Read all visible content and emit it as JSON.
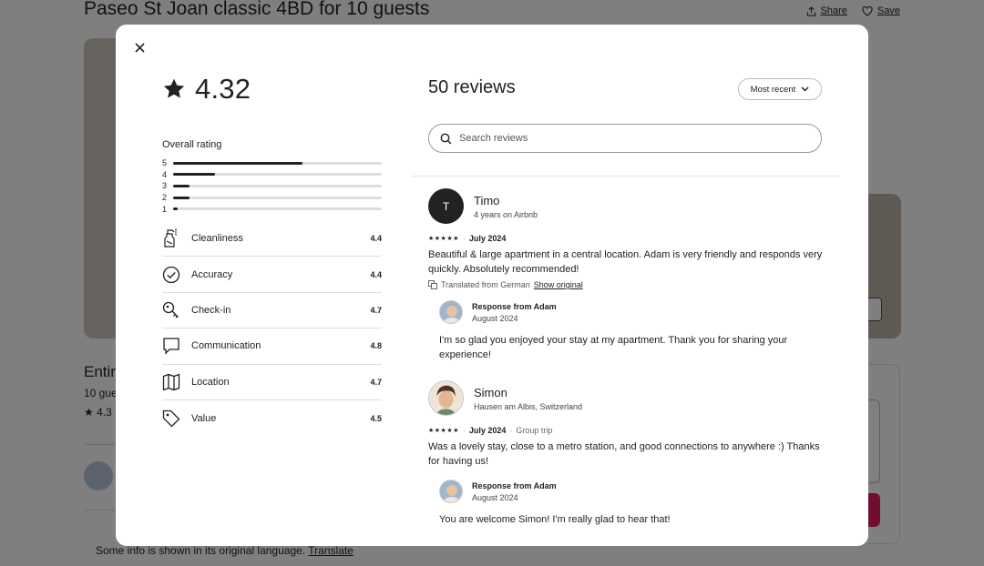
{
  "background": {
    "title": "Paseo St Joan classic 4BD for 10 guests",
    "share_label": "Share",
    "save_label": "Save",
    "entire_text": "Entir",
    "guests_text": "10 gue",
    "rating_text": "4.3",
    "translate_note": "Some info is shown in its original language.",
    "translate_link": "Translate"
  },
  "modal": {
    "overall_score": "4.32",
    "overall_label": "Overall rating",
    "distribution": [
      {
        "stars": "5",
        "fraction": 0.62
      },
      {
        "stars": "4",
        "fraction": 0.2
      },
      {
        "stars": "3",
        "fraction": 0.08
      },
      {
        "stars": "2",
        "fraction": 0.08
      },
      {
        "stars": "1",
        "fraction": 0.02
      }
    ],
    "categories": [
      {
        "name": "Cleanliness",
        "value": "4.4",
        "icon": "spray-bottle-icon"
      },
      {
        "name": "Accuracy",
        "value": "4.4",
        "icon": "check-circle-icon"
      },
      {
        "name": "Check-in",
        "value": "4.7",
        "icon": "key-icon"
      },
      {
        "name": "Communication",
        "value": "4.8",
        "icon": "chat-bubble-icon"
      },
      {
        "name": "Location",
        "value": "4.7",
        "icon": "map-icon"
      },
      {
        "name": "Value",
        "value": "4.5",
        "icon": "tag-icon"
      }
    ],
    "reviews_title": "50 reviews",
    "sort_label": "Most recent",
    "search_placeholder": "Search reviews",
    "reviews": [
      {
        "initial": "T",
        "name": "Timo",
        "subtitle": "4 years on Airbnb",
        "stars": "★★★★★",
        "date": "July 2024",
        "trip": "",
        "text": "Beautiful & large apartment in a central location. Adam is very friendly and responds very quickly. Absolutely recommended!",
        "translated": "Translated from German",
        "show_original": "Show original",
        "response_title": "Response from Adam",
        "response_date": "August 2024",
        "response_text": "I'm so glad you enjoyed your stay at my apartment. Thank you for sharing your experience!"
      },
      {
        "initial": "",
        "name": "Simon",
        "subtitle": "Hausen am Albis, Switzerland",
        "stars": "★★★★★",
        "date": "July 2024",
        "trip": "Group trip",
        "text": "Was a lovely stay, close to a metro station, and good connections to anywhere :) Thanks for having us!",
        "response_title": "Response from Adam",
        "response_date": "August 2024",
        "response_text": "You are welcome Simon! I'm really glad to hear that!"
      }
    ]
  }
}
